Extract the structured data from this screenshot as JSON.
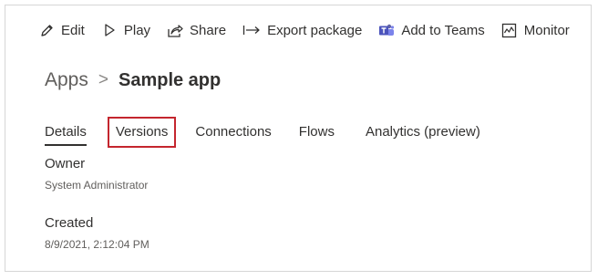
{
  "toolbar": {
    "items": [
      {
        "label": "Edit",
        "icon": "pencil-icon"
      },
      {
        "label": "Play",
        "icon": "play-icon"
      },
      {
        "label": "Share",
        "icon": "share-icon"
      },
      {
        "label": "Export package",
        "icon": "export-arrow-icon"
      },
      {
        "label": "Add to Teams",
        "icon": "teams-icon"
      },
      {
        "label": "Monitor",
        "icon": "monitor-icon"
      }
    ]
  },
  "breadcrumb": {
    "root": "Apps",
    "separator": ">",
    "current": "Sample app"
  },
  "tabs": {
    "items": [
      {
        "label": "Details",
        "active": true
      },
      {
        "label": "Versions",
        "active": false,
        "highlighted": true
      },
      {
        "label": "Connections",
        "active": false
      },
      {
        "label": "Flows",
        "active": false
      },
      {
        "label": "Analytics (preview)",
        "active": false
      }
    ]
  },
  "details": {
    "owner_label": "Owner",
    "owner_value": "System Administrator",
    "created_label": "Created",
    "created_value": "8/9/2021, 2:12:04 PM"
  },
  "colors": {
    "highlight_border": "#c4262e",
    "text": "#323130",
    "muted": "#605e5c",
    "teams_purple": "#6264a7"
  }
}
